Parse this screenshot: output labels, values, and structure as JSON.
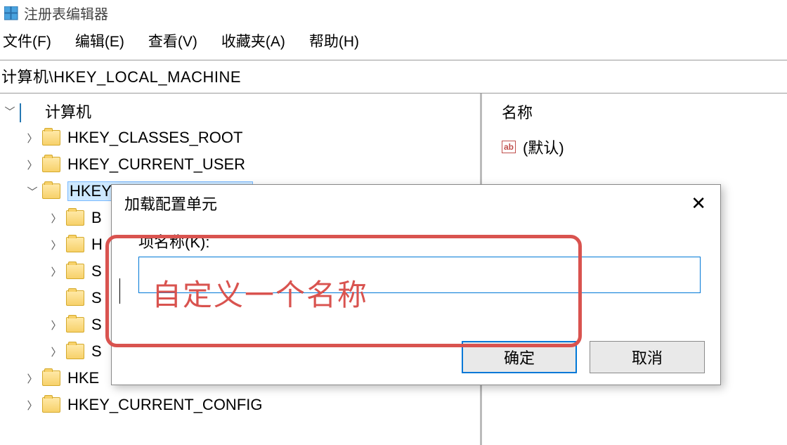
{
  "window": {
    "title": "注册表编辑器"
  },
  "menu": {
    "file": "文件(F)",
    "edit": "编辑(E)",
    "view": "查看(V)",
    "favorites": "收藏夹(A)",
    "help": "帮助(H)"
  },
  "address": "计算机\\HKEY_LOCAL_MACHINE",
  "tree": {
    "root": "计算机",
    "hkcr": "HKEY_CLASSES_ROOT",
    "hkcu": "HKEY_CURRENT_USER",
    "hklm": "HKEY_LOCAL_MACHINE",
    "hklm_children": {
      "b": "B",
      "h": "H",
      "sa": "S",
      "so": "S",
      "sw": "S",
      "sy": "S"
    },
    "hku": "HKE",
    "hkcc": "HKEY_CURRENT_CONFIG"
  },
  "values": {
    "header_name": "名称",
    "default_label": "(默认)"
  },
  "dialog": {
    "title": "加载配置单元",
    "field_label": "项名称(K):",
    "input_value": "",
    "ok": "确定",
    "cancel": "取消"
  },
  "annotation": {
    "text": "自定义一个名称"
  }
}
